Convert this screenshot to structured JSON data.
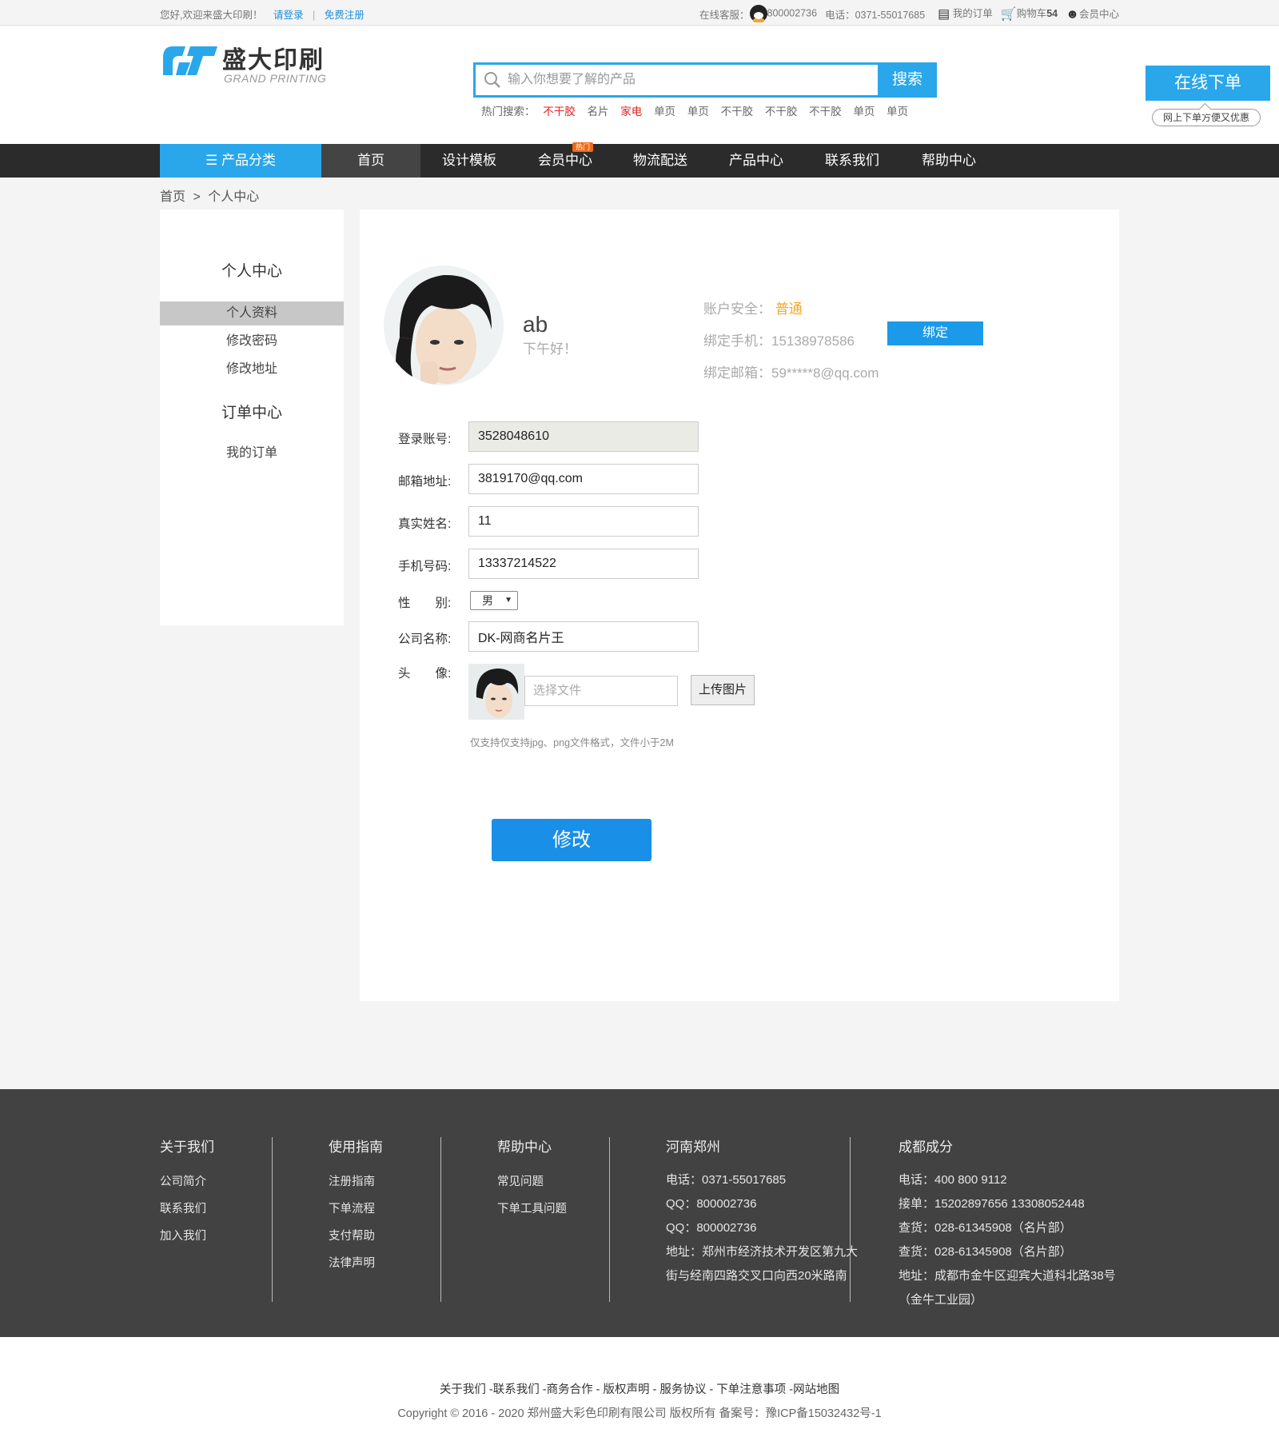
{
  "topbar": {
    "welcome": "您好,欢迎来盛大印刷！",
    "login": "请登录",
    "register": "免费注册",
    "service_label": "在线客服：",
    "service_qq": "800002736",
    "phone": "电话：0371-55017685",
    "my_orders": "我的订单",
    "cart": "购物车",
    "cart_count": "54",
    "member": "会员中心"
  },
  "header": {
    "logo_cn": "盛大印刷",
    "logo_en": "GRAND PRINTING",
    "search_placeholder": "输入你想要了解的产品",
    "search_btn": "搜索",
    "hot_label": "热门搜索：",
    "hot": [
      {
        "t": "不干胶",
        "red": true
      },
      {
        "t": "名片",
        "red": false
      },
      {
        "t": "家电",
        "red": true
      },
      {
        "t": "单页",
        "red": false
      },
      {
        "t": "单页",
        "red": false
      },
      {
        "t": "不干胶",
        "red": false
      },
      {
        "t": "不干胶",
        "red": false
      },
      {
        "t": "不干胶",
        "red": false
      },
      {
        "t": "单页",
        "red": false
      },
      {
        "t": "单页",
        "red": false
      }
    ],
    "order_btn": "在线下单",
    "order_tip": "网上下单方便又优惠"
  },
  "nav": {
    "category": "产品分类",
    "items": [
      "首页",
      "设计模板",
      "会员中心",
      "物流配送",
      "产品中心",
      "联系我们",
      "帮助中心"
    ],
    "hot_badge": "热门"
  },
  "breadcrumb": {
    "home": "首页",
    "sep": ">",
    "current": "个人中心"
  },
  "sidebar": {
    "title": "个人中心",
    "items": [
      "个人资料",
      "修改密码",
      "修改地址"
    ],
    "orders_title": "订单中心",
    "orders_items": [
      "我的订单"
    ]
  },
  "profile": {
    "name": "ab",
    "greeting": "下午好！",
    "security_label": "账户安全：",
    "security_value": "普通",
    "phone_label": "绑定手机：",
    "phone_value": "15138978586",
    "bind_btn": "绑定",
    "email_label": "绑定邮箱：",
    "email_value": "59*****8@qq.com"
  },
  "form": {
    "account_label": "登录账号:",
    "account_value": "3528048610",
    "email_label": "邮箱地址:",
    "email_value": "3819170@qq.com",
    "realname_label": "真实姓名:",
    "realname_value": "11",
    "mobile_label": "手机号码:",
    "mobile_value": "13337214522",
    "gender_label": "性　　别:",
    "gender_value": "男",
    "company_label": "公司名称:",
    "company_value": "DK-网商名片王",
    "avatar_label": "头　　像:",
    "file_placeholder": "选择文件",
    "upload_btn": "上传图片",
    "tip": "仅支持仅支持jpg、png文件格式，文件小于2M",
    "submit": "修改"
  },
  "footer": {
    "about": {
      "title": "关于我们",
      "items": [
        "公司简介",
        "联系我们",
        "加入我们"
      ]
    },
    "guide": {
      "title": "使用指南",
      "items": [
        "注册指南",
        "下单流程",
        "支付帮助",
        "法律声明"
      ]
    },
    "help": {
      "title": "帮助中心",
      "items": [
        "常见问题",
        "下单工具问题"
      ]
    },
    "zhengzhou": {
      "title": "河南郑州",
      "lines": [
        "电话：0371-55017685",
        "QQ：800002736",
        "QQ：800002736",
        "地址：郑州市经济技术开发区第九大",
        "街与经南四路交叉口向西20米路南"
      ]
    },
    "chengdu": {
      "title": "成都成分",
      "lines": [
        "电话：400 800 9112",
        "接单：15202897656 13308052448",
        "查货：028-61345908（名片部）",
        "查货：028-61345908（名片部）",
        "地址：成都市金牛区迎宾大道科北路38号",
        "（金牛工业园）"
      ]
    },
    "links": "关于我们 -联系我们 -商务合作 - 版权声明 - 服务协议 - 下单注意事项 -网站地图",
    "copyright": "Copyright © 2016 - 2020 郑州盛大彩色印刷有限公司 版权所有 备案号：豫ICP备15032432号-1"
  }
}
